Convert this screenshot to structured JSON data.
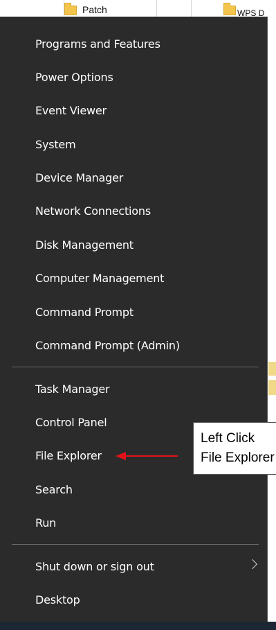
{
  "background": {
    "folder_label": "Patch",
    "file_label": "WPS D"
  },
  "menu": {
    "group1": [
      "Programs and Features",
      "Power Options",
      "Event Viewer",
      "System",
      "Device Manager",
      "Network Connections",
      "Disk Management",
      "Computer Management",
      "Command Prompt",
      "Command Prompt (Admin)"
    ],
    "group2": [
      "Task Manager",
      "Control Panel",
      "File Explorer",
      "Search",
      "Run"
    ],
    "group3": [
      "Shut down or sign out",
      "Desktop"
    ]
  },
  "annotation": {
    "line1": "Left Click",
    "line2": "File Explorer",
    "arrow_color": "#e3121a"
  },
  "icons": {
    "submenu": "chevron-right-icon",
    "folder": "folder-icon"
  }
}
